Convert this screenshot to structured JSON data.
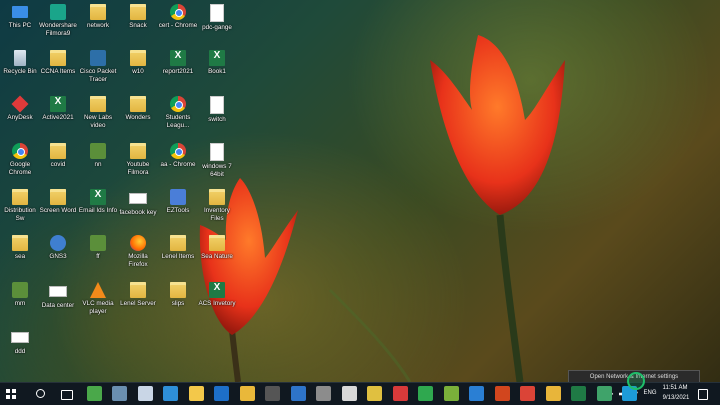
{
  "desktop_icons": [
    {
      "label": "This PC",
      "icon": "pc-icon"
    },
    {
      "label": "Wondershare Filmora9",
      "icon": "filmora-icon"
    },
    {
      "label": "network",
      "icon": "folder-icon"
    },
    {
      "label": "Snack",
      "icon": "folder-icon"
    },
    {
      "label": "cert - Chrome",
      "icon": "chrome-icon"
    },
    {
      "label": "pdc-gange",
      "icon": "document-icon"
    },
    {
      "label": "Recycle Bin",
      "icon": "recycle-bin-icon"
    },
    {
      "label": "CCNA Items",
      "icon": "folder-icon"
    },
    {
      "label": "Cisco Packet Tracer",
      "icon": "cisco-icon"
    },
    {
      "label": "w10",
      "icon": "folder-icon"
    },
    {
      "label": "report2021",
      "icon": "excel-icon"
    },
    {
      "label": "Book1",
      "icon": "excel-icon"
    },
    {
      "label": "AnyDesk",
      "icon": "anydesk-icon"
    },
    {
      "label": "Active2021",
      "icon": "excel-icon"
    },
    {
      "label": "New Labs video",
      "icon": "folder-icon"
    },
    {
      "label": "Wonders",
      "icon": "folder-icon"
    },
    {
      "label": "Students Leagu...",
      "icon": "chrome-icon"
    },
    {
      "label": "switch",
      "icon": "document-icon"
    },
    {
      "label": "Google Chrome",
      "icon": "chrome-icon"
    },
    {
      "label": "covid",
      "icon": "folder-icon"
    },
    {
      "label": "nn",
      "icon": "network-tool-icon"
    },
    {
      "label": "Youtube Filmora",
      "icon": "folder-icon"
    },
    {
      "label": "aa - Chrome",
      "icon": "chrome-icon"
    },
    {
      "label": "windows 7 64bit",
      "icon": "document-icon"
    },
    {
      "label": "Distribution Sw",
      "icon": "folder-icon"
    },
    {
      "label": "Screen Word",
      "icon": "folder-icon"
    },
    {
      "label": "Email Ids Info",
      "icon": "excel-icon"
    },
    {
      "label": "facebook key",
      "icon": "card-icon"
    },
    {
      "label": "EZTools",
      "icon": "tools-icon"
    },
    {
      "label": "Inventory Files",
      "icon": "folder-icon"
    },
    {
      "label": "sea",
      "icon": "folder-icon"
    },
    {
      "label": "GNS3",
      "icon": "gns3-icon"
    },
    {
      "label": "ff",
      "icon": "network-tool-icon"
    },
    {
      "label": "Mozilla Firefox",
      "icon": "firefox-icon"
    },
    {
      "label": "Lenel Items",
      "icon": "folder-icon"
    },
    {
      "label": "Sea Nature",
      "icon": "folder-icon"
    },
    {
      "label": "mm",
      "icon": "network-tool-icon"
    },
    {
      "label": "Data center",
      "icon": "card-icon"
    },
    {
      "label": "VLC media player",
      "icon": "vlc-icon"
    },
    {
      "label": "Lenel Server",
      "icon": "folder-icon"
    },
    {
      "label": "slips",
      "icon": "folder-icon"
    },
    {
      "label": "ACS Invetory",
      "icon": "excel-icon"
    },
    {
      "label": "ddd",
      "icon": "card-icon"
    }
  ],
  "taskbar": {
    "pinned": [
      {
        "name": "start-button",
        "icon": "windows-icon",
        "color": "#ffffff"
      },
      {
        "name": "search-button",
        "icon": "search-icon",
        "color": "#ffffff"
      },
      {
        "name": "task-view-button",
        "icon": "task-view-icon",
        "color": "#ffffff"
      },
      {
        "name": "app-1",
        "icon": "app-icon",
        "color": "#4aa84a"
      },
      {
        "name": "app-2",
        "icon": "app-icon",
        "color": "#6a8fb0"
      },
      {
        "name": "app-3",
        "icon": "app-icon",
        "color": "#c9d6e6"
      },
      {
        "name": "app-4",
        "icon": "app-icon",
        "color": "#2e8fd8"
      },
      {
        "name": "file-explorer",
        "icon": "folder-icon",
        "color": "#f3c84a"
      },
      {
        "name": "outlook",
        "icon": "outlook-icon",
        "color": "#1d6fc9"
      },
      {
        "name": "chrome",
        "icon": "chrome-icon",
        "color": "#e9b83a"
      },
      {
        "name": "app-5",
        "icon": "app-icon",
        "color": "#555555"
      },
      {
        "name": "app-6",
        "icon": "app-icon",
        "color": "#2e74c9"
      },
      {
        "name": "app-7",
        "icon": "app-icon",
        "color": "#8c8c8c"
      },
      {
        "name": "app-8",
        "icon": "app-icon",
        "color": "#d8d8d8"
      },
      {
        "name": "app-9",
        "icon": "app-icon",
        "color": "#e0c040"
      },
      {
        "name": "app-10",
        "icon": "app-icon",
        "color": "#d83a3a"
      },
      {
        "name": "app-11",
        "icon": "app-icon",
        "color": "#2fa84f"
      },
      {
        "name": "app-12",
        "icon": "app-icon",
        "color": "#7ab03a"
      },
      {
        "name": "app-13",
        "icon": "app-icon",
        "color": "#2a7fd4"
      },
      {
        "name": "powerpoint",
        "icon": "powerpoint-icon",
        "color": "#d2461e"
      },
      {
        "name": "chrome-2",
        "icon": "chrome-icon",
        "color": "#db4437"
      },
      {
        "name": "app-14",
        "icon": "app-icon",
        "color": "#e8b53a"
      },
      {
        "name": "excel",
        "icon": "excel-icon",
        "color": "#1f7a45"
      },
      {
        "name": "app-15",
        "icon": "app-icon",
        "color": "#3fa36a"
      },
      {
        "name": "app-16",
        "icon": "app-icon",
        "color": "#1d9bd8"
      }
    ],
    "tray": {
      "language": "ENG",
      "time": "11:51 AM",
      "date": "9/13/2021"
    },
    "tooltip": "Open Network & Internet settings"
  }
}
